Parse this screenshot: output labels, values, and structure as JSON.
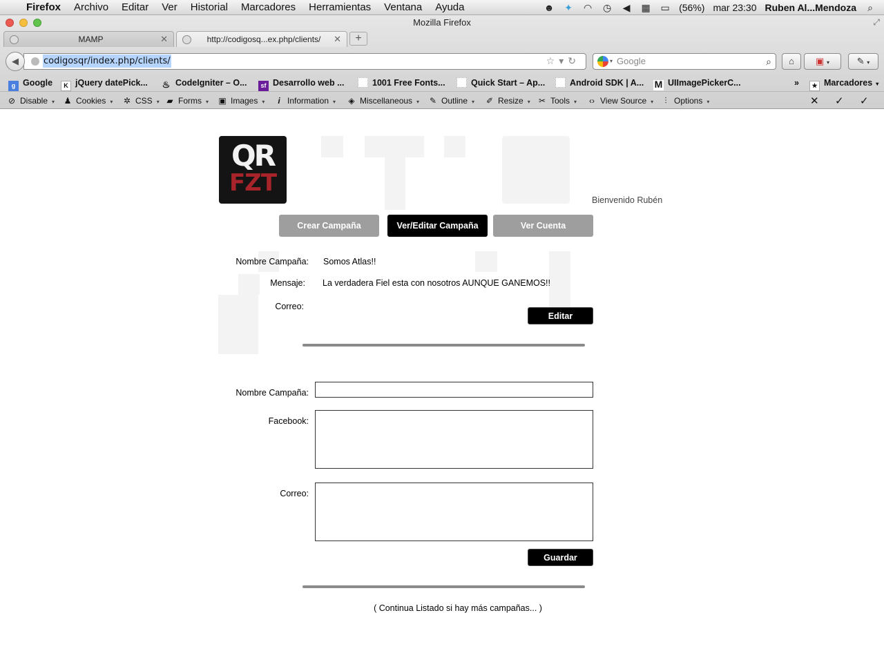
{
  "menubar": {
    "apple": "",
    "app": "Firefox",
    "items": [
      "Archivo",
      "Editar",
      "Ver",
      "Historial",
      "Marcadores",
      "Herramientas",
      "Ventana",
      "Ayuda"
    ],
    "battery": "(56%)",
    "clock": "mar 23:30",
    "user": "Ruben Al...Mendoza"
  },
  "window": {
    "title": "Mozilla Firefox"
  },
  "tabs": [
    {
      "label": "MAMP"
    },
    {
      "label": "http://codigosq...ex.php/clients/"
    }
  ],
  "urlbar": {
    "url": "codigosqr/index.php/clients/"
  },
  "search": {
    "placeholder": "Google"
  },
  "bookmarks": {
    "items": [
      {
        "label": "Google",
        "icon": "g"
      },
      {
        "label": "jQuery datePick...",
        "icon": "KL"
      },
      {
        "label": "CodeIgniter – O...",
        "icon": "flame"
      },
      {
        "label": "Desarrollo web ...",
        "icon": "sf"
      },
      {
        "label": "1001 Free Fonts...",
        "icon": "page"
      },
      {
        "label": "Quick Start – Ap...",
        "icon": "page"
      },
      {
        "label": "Android SDK | A...",
        "icon": "page"
      },
      {
        "label": "UIImagePickerC...",
        "icon": "M"
      }
    ],
    "overflow": "»",
    "folder": "Marcadores"
  },
  "webdev": {
    "items": [
      "Disable",
      "Cookies",
      "CSS",
      "Forms",
      "Images",
      "Information",
      "Miscellaneous",
      "Outline",
      "Resize",
      "Tools",
      "View Source",
      "Options"
    ]
  },
  "page": {
    "welcome": "Bienvenido Rubén",
    "nav": {
      "create": "Crear Campaña",
      "view_edit": "Ver/Editar Campaña",
      "account": "Ver Cuenta"
    },
    "campaign": {
      "name_label": "Nombre Campaña:",
      "name_value": "Somos Atlas!!",
      "message_label": "Mensaje:",
      "message_value": "La verdadera Fiel esta con nosotros AUNQUE GANEMOS!!",
      "email_label": "Correo:",
      "edit_button": "Editar"
    },
    "form": {
      "name_label": "Nombre Campaña:",
      "name_value": "",
      "facebook_label": "Facebook:",
      "facebook_value": "",
      "email_label": "Correo:",
      "email_value": "",
      "save_button": "Guardar"
    },
    "footer_note": "( Continua Listado si hay más campañas... )"
  }
}
